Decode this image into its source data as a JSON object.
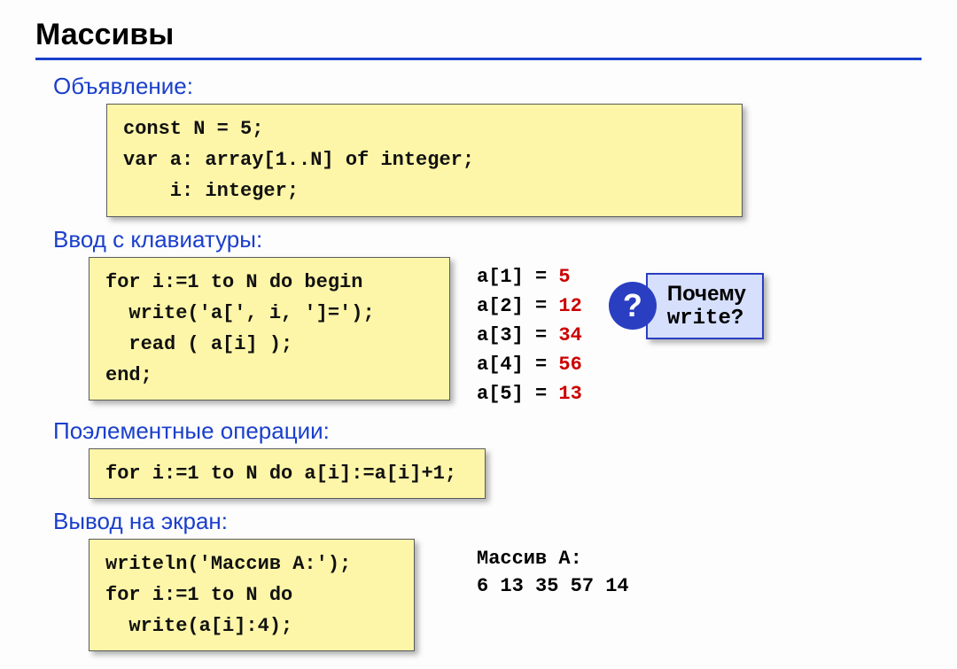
{
  "title": "Массивы",
  "sections": {
    "declaration": {
      "label": "Объявление:",
      "code": "const N = 5;\nvar a: array[1..N] of integer;\n    i: integer;"
    },
    "input": {
      "label": "Ввод с клавиатуры:",
      "code": "for i:=1 to N do begin\n  write('a[', i, ']=');\n  read ( a[i] );\nend;",
      "sample": [
        {
          "key": "a[1] = ",
          "val": "5"
        },
        {
          "key": "a[2] = ",
          "val": "12"
        },
        {
          "key": "a[3] = ",
          "val": "34"
        },
        {
          "key": "a[4] = ",
          "val": "56"
        },
        {
          "key": "a[5] = ",
          "val": "13"
        }
      ],
      "callout": {
        "icon": "?",
        "line1": "Почему",
        "line2": "write?"
      }
    },
    "elementwise": {
      "label": "Поэлементные операции:",
      "code": "for i:=1 to N do a[i]:=a[i]+1;"
    },
    "output": {
      "label": "Вывод на экран:",
      "code": "writeln('Массив A:');\nfor i:=1 to N do\n  write(a[i]:4);",
      "result_label": "Массив A:",
      "result_values": "  6   13   35   57   14"
    }
  }
}
